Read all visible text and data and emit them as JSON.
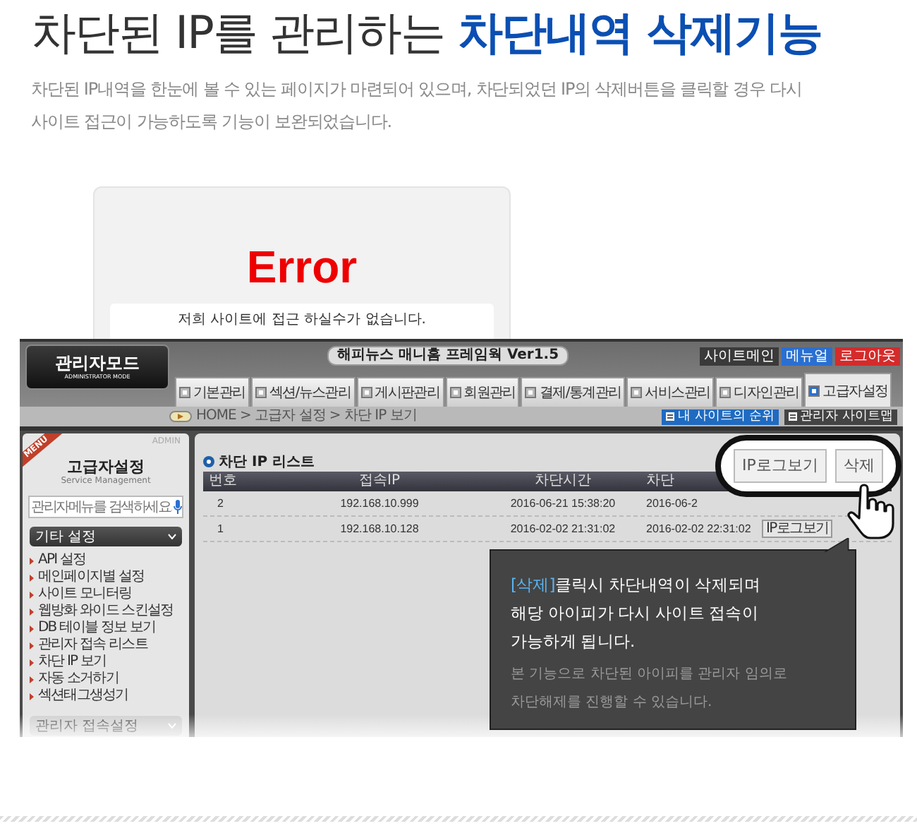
{
  "heading": {
    "plain": "차단된 IP를 관리하는",
    "highlight": "차단내역 삭제기능"
  },
  "description_lines": [
    "차단된 IP내역을 한눈에 볼 수 있는 페이지가 마련되어 있으며, 차단되었던 IP의 삭제버튼을 클릭할 경우 다시",
    "사이트 접근이 가능하도록 기능이 보완되었습니다."
  ],
  "error_page": {
    "title": "Error",
    "message": "저희 사이트에 접근 하실수가 없습니다."
  },
  "admin": {
    "logo": {
      "title": "관리자모드",
      "subtitle": "ADMINISTRATOR MODE"
    },
    "app_title": "해피뉴스 매니홈 프레임웍 Ver1.5",
    "top_buttons": [
      {
        "label": "사이트메인",
        "color": "#3a3a3a"
      },
      {
        "label": "메뉴얼",
        "color": "#2a6fd0"
      },
      {
        "label": "로그아웃",
        "color": "#d42b2b"
      }
    ],
    "tabs": [
      {
        "label": "기본관리",
        "selected": false
      },
      {
        "label": "섹션/뉴스관리",
        "selected": false
      },
      {
        "label": "게시판관리",
        "selected": false
      },
      {
        "label": "회원관리",
        "selected": false
      },
      {
        "label": "결제/통계관리",
        "selected": false
      },
      {
        "label": "서비스관리",
        "selected": false
      },
      {
        "label": "디자인관리",
        "selected": false
      },
      {
        "label": "고급자설정",
        "selected": true
      }
    ],
    "breadcrumb": "HOME > 고급자 설정 > 차단 IP 보기",
    "toolbar_buttons": [
      "내 사이트의 순위",
      "관리자 사이트맵"
    ],
    "sidebar": {
      "ribbon": "MENU",
      "badge": "ADMIN",
      "title": "고급자설정",
      "subtitle": "Service Management",
      "search_placeholder": "관리자메뉴를 검색하세요.",
      "group": "기타 설정",
      "items": [
        "API 설정",
        "메인페이지별 설정",
        "사이트 모니터링",
        "웹방화 와이드 스킨설정",
        "DB 테이블 정보 보기",
        "관리자 접속 리스트",
        "차단 IP 보기",
        "자동 소거하기",
        "섹션태그생성기"
      ],
      "next_group": "관리자 접속설정"
    },
    "list": {
      "title": "차단 IP 리스트",
      "columns": [
        "번호",
        "접속IP",
        "차단시간",
        "차단"
      ],
      "rows": [
        {
          "cells": [
            "2",
            "192.168.10.999",
            "2016-06-21 15:38:20",
            "2016-06-2"
          ],
          "actions": []
        },
        {
          "cells": [
            "1",
            "192.168.10.128",
            "2016-02-02 21:31:02",
            "2016-02-02 22:31:02"
          ],
          "actions": [
            "IP로그보기"
          ]
        }
      ]
    }
  },
  "callout": {
    "buttons": [
      "IP로그보기",
      "삭제"
    ]
  },
  "tooltip": {
    "highlight": "[삭제]",
    "lines": [
      "클릭시 차단내역이 삭제되며",
      "해당 아이피가 다시 사이트 접속이",
      "가능하게 됩니다."
    ],
    "note_lines": [
      "본 기능으로 차단된 아이피를 관리자 임의로",
      "차단해제를 진행할 수 있습니다."
    ]
  }
}
